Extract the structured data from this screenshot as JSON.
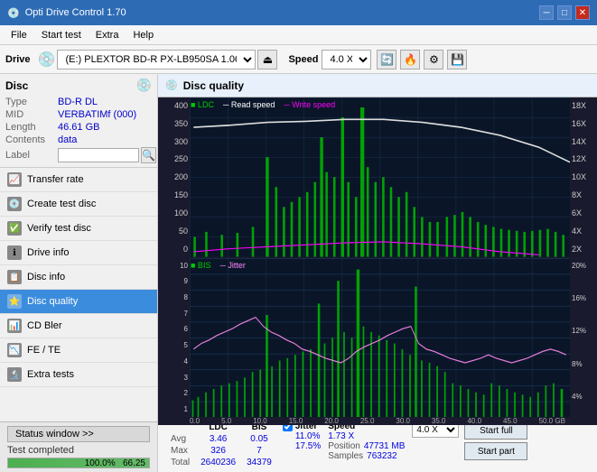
{
  "app": {
    "title": "Opti Drive Control 1.70",
    "title_icon": "💿"
  },
  "title_bar": {
    "controls": [
      "─",
      "□",
      "✕"
    ]
  },
  "menu": {
    "items": [
      "File",
      "Start test",
      "Extra",
      "Help"
    ]
  },
  "drive_bar": {
    "label": "Drive",
    "drive_value": "(E:)  PLEXTOR BD-R  PX-LB950SA 1.06",
    "speed_label": "Speed",
    "speed_value": "4.0 X"
  },
  "disc_panel": {
    "title": "Disc",
    "type_label": "Type",
    "type_value": "BD-R DL",
    "mid_label": "MID",
    "mid_value": "VERBATIMf (000)",
    "length_label": "Length",
    "length_value": "46.61 GB",
    "contents_label": "Contents",
    "contents_value": "data",
    "label_label": "Label",
    "label_placeholder": ""
  },
  "nav": {
    "items": [
      {
        "id": "transfer-rate",
        "label": "Transfer rate",
        "icon": "📈"
      },
      {
        "id": "create-test-disc",
        "label": "Create test disc",
        "icon": "💿"
      },
      {
        "id": "verify-test-disc",
        "label": "Verify test disc",
        "icon": "✅"
      },
      {
        "id": "drive-info",
        "label": "Drive info",
        "icon": "ℹ"
      },
      {
        "id": "disc-info",
        "label": "Disc info",
        "icon": "📋"
      },
      {
        "id": "disc-quality",
        "label": "Disc quality",
        "icon": "⭐",
        "active": true
      },
      {
        "id": "cd-bler",
        "label": "CD Bler",
        "icon": "📊"
      },
      {
        "id": "fe-te",
        "label": "FE / TE",
        "icon": "📉"
      },
      {
        "id": "extra-tests",
        "label": "Extra tests",
        "icon": "🔬"
      }
    ]
  },
  "status": {
    "window_btn": "Status window >>",
    "status_text": "Test completed",
    "progress_pct": 100,
    "progress_label": "100.0%",
    "extra_val": "66.25"
  },
  "content": {
    "header_icon": "💿",
    "title": "Disc quality",
    "legend": [
      {
        "label": "LDC",
        "color": "#00aa00"
      },
      {
        "label": "Read speed",
        "color": "#ffffff"
      },
      {
        "label": "Write speed",
        "color": "#ff00ff"
      }
    ],
    "legend2": [
      {
        "label": "BIS",
        "color": "#00cc00"
      },
      {
        "label": "Jitter",
        "color": "#ff88ff"
      }
    ]
  },
  "chart1": {
    "y_left": [
      "400",
      "350",
      "300",
      "250",
      "200",
      "150",
      "100",
      "50",
      "0"
    ],
    "y_right": [
      "18X",
      "16X",
      "14X",
      "12X",
      "10X",
      "8X",
      "6X",
      "4X",
      "2X"
    ],
    "x_labels": [
      "0.0",
      "5.0",
      "10.0",
      "15.0",
      "20.0",
      "25.0",
      "30.0",
      "35.0",
      "40.0",
      "45.0",
      "50.0 GB"
    ]
  },
  "chart2": {
    "y_left": [
      "10",
      "9",
      "8",
      "7",
      "6",
      "5",
      "4",
      "3",
      "2",
      "1"
    ],
    "y_right": [
      "20%",
      "16%",
      "12%",
      "8%",
      "4%"
    ],
    "x_labels": [
      "0.0",
      "5.0",
      "10.0",
      "15.0",
      "20.0",
      "25.0",
      "30.0",
      "35.0",
      "40.0",
      "45.0",
      "50.0 GB"
    ]
  },
  "stats": {
    "headers": [
      "",
      "LDC",
      "BIS",
      "",
      "Jitter",
      "Speed",
      ""
    ],
    "rows": [
      {
        "label": "Avg",
        "ldc": "3.46",
        "bis": "0.05",
        "jitter": "11.0%",
        "speed_val": "1.73 X"
      },
      {
        "label": "Max",
        "ldc": "326",
        "bis": "7",
        "jitter": "17.5%",
        "speed_label": "Position",
        "speed_val": "47731 MB"
      },
      {
        "label": "Total",
        "ldc": "2640236",
        "bis": "34379",
        "jitter": "",
        "speed_label": "Samples",
        "speed_val": "763232"
      }
    ],
    "speed_dropdown": "4.0 X",
    "btn_start_full": "Start full",
    "btn_start_part": "Start part"
  }
}
